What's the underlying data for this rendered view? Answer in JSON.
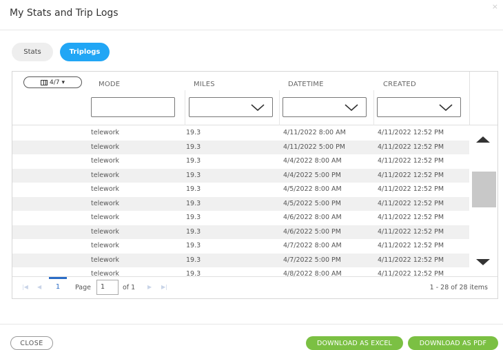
{
  "dialog": {
    "title": "My Stats and Trip Logs",
    "close_icon": "×"
  },
  "tabs": [
    {
      "label": "Stats",
      "active": false
    },
    {
      "label": "Triplogs",
      "active": true
    }
  ],
  "grid": {
    "column_picker": "4/7",
    "columns": [
      "MODE",
      "MILES",
      "DATETIME",
      "CREATED"
    ],
    "rows": [
      {
        "mode": "telework",
        "miles": "19.3",
        "datetime": "4/11/2022 8:00 AM",
        "created": "4/11/2022 12:52 PM"
      },
      {
        "mode": "telework",
        "miles": "19.3",
        "datetime": "4/11/2022 5:00 PM",
        "created": "4/11/2022 12:52 PM"
      },
      {
        "mode": "telework",
        "miles": "19.3",
        "datetime": "4/4/2022 8:00 AM",
        "created": "4/11/2022 12:52 PM"
      },
      {
        "mode": "telework",
        "miles": "19.3",
        "datetime": "4/4/2022 5:00 PM",
        "created": "4/11/2022 12:52 PM"
      },
      {
        "mode": "telework",
        "miles": "19.3",
        "datetime": "4/5/2022 8:00 AM",
        "created": "4/11/2022 12:52 PM"
      },
      {
        "mode": "telework",
        "miles": "19.3",
        "datetime": "4/5/2022 5:00 PM",
        "created": "4/11/2022 12:52 PM"
      },
      {
        "mode": "telework",
        "miles": "19.3",
        "datetime": "4/6/2022 8:00 AM",
        "created": "4/11/2022 12:52 PM"
      },
      {
        "mode": "telework",
        "miles": "19.3",
        "datetime": "4/6/2022 5:00 PM",
        "created": "4/11/2022 12:52 PM"
      },
      {
        "mode": "telework",
        "miles": "19.3",
        "datetime": "4/7/2022 8:00 AM",
        "created": "4/11/2022 12:52 PM"
      },
      {
        "mode": "telework",
        "miles": "19.3",
        "datetime": "4/7/2022 5:00 PM",
        "created": "4/11/2022 12:52 PM"
      },
      {
        "mode": "telework",
        "miles": "19.3",
        "datetime": "4/8/2022 8:00 AM",
        "created": "4/11/2022 12:52 PM"
      }
    ]
  },
  "pager": {
    "first_icon": "|◀",
    "prev_icon": "◀",
    "current_page": "1",
    "page_label": "Page",
    "page_input": "1",
    "of_label": "of 1",
    "next_icon": "▶",
    "last_icon": "▶|",
    "info": "1 - 28 of 28 items"
  },
  "footer": {
    "close_label": "CLOSE",
    "download_excel_label": "DOWNLOAD AS EXCEL",
    "download_pdf_label": "DOWNLOAD AS PDF"
  },
  "colors": {
    "accent": "#21a6f5",
    "download": "#7bc043",
    "pager_active": "#2a6cc6"
  }
}
